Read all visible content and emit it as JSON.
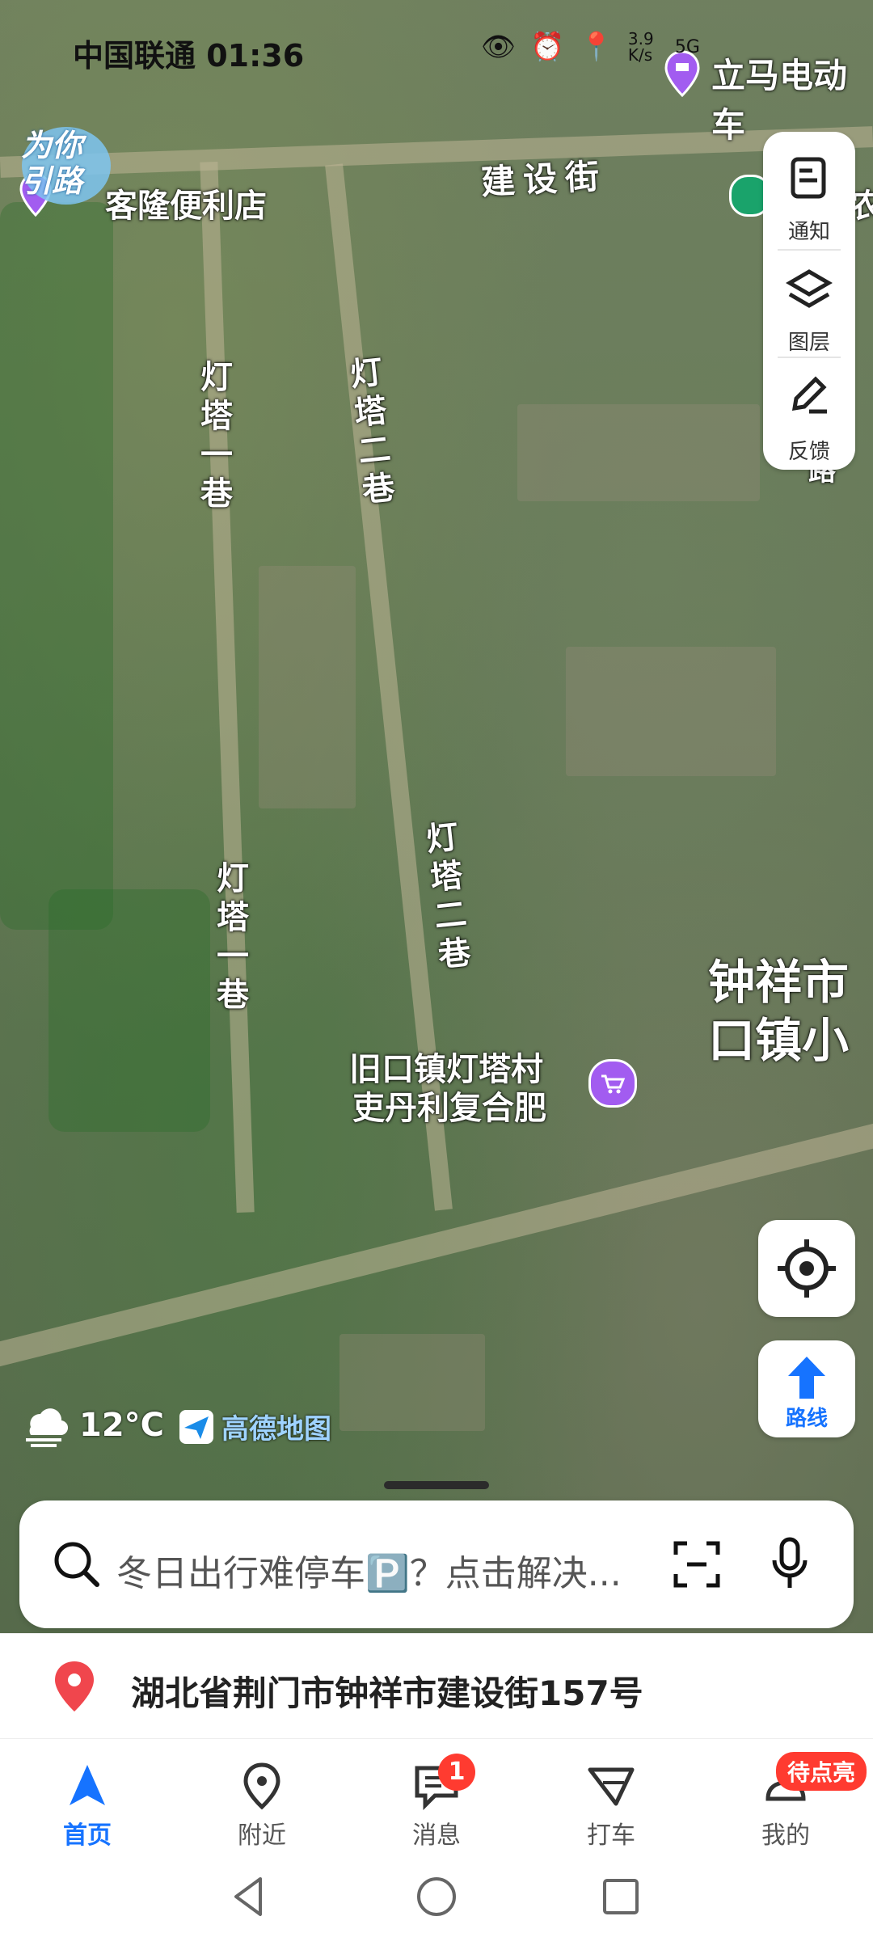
{
  "status_bar": {
    "carrier_time": "中国联通 01:36",
    "speed": "3.9 K/s",
    "network": "5G"
  },
  "map": {
    "labels": {
      "top_right_poi": "立马电动车",
      "store": "客隆便利店",
      "street": "建设街",
      "lane1_top": "灯塔一巷",
      "lane2_top": "灯塔二巷",
      "lane1_bottom": "灯塔一巷",
      "lane2_bottom": "灯塔二巷",
      "poi_fertilizer_line1": "旧口镇灯塔村",
      "poi_fertilizer_line2": "吏丹利复合肥",
      "district_line1": "钟祥市",
      "district_line2": "口镇小",
      "right_edge_1": "农",
      "right_edge_2": "路"
    },
    "badge_text": "为你引路",
    "weather": {
      "temp": "12°C",
      "icon": "cloud-haze-icon"
    },
    "brand": "高德地图"
  },
  "toolbar": {
    "notify": "通知",
    "layers": "图层",
    "feedback": "反馈"
  },
  "locate_button": {
    "icon": "locate-icon"
  },
  "route_button": {
    "label": "路线"
  },
  "search": {
    "placeholder": "冬日出行难停车🅿️？点击解决..."
  },
  "address": {
    "text": "湖北省荆门市钟祥市建设街157号"
  },
  "nav": {
    "home": "首页",
    "nearby": "附近",
    "messages": "消息",
    "messages_badge": "1",
    "taxi": "打车",
    "mine": "我的",
    "mine_badge": "待点亮"
  },
  "colors": {
    "accent": "#1673ff",
    "badge": "#ff3b30",
    "pin": "#f0464d"
  }
}
